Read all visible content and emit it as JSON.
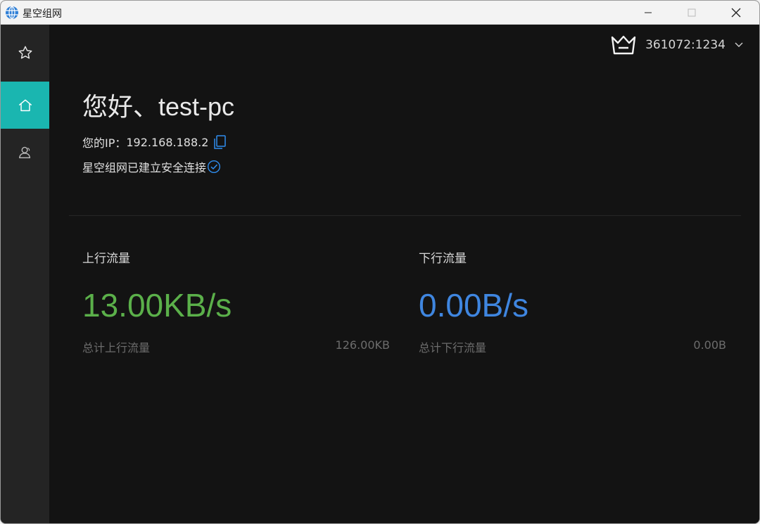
{
  "window": {
    "title": "星空组网"
  },
  "sidebar": {
    "items": [
      {
        "icon": "star-icon",
        "active": false
      },
      {
        "icon": "home-icon",
        "active": true
      },
      {
        "icon": "contacts-icon",
        "active": false
      }
    ]
  },
  "header": {
    "account_icon": "crown-icon",
    "account_id": "361072:1234"
  },
  "main": {
    "greeting": "您好、test-pc",
    "ip_label": "您的IP：",
    "ip_value": "192.168.188.2",
    "connection_status": "星空组网已建立安全连接"
  },
  "stats": {
    "upload": {
      "title": "上行流量",
      "rate": "13.00KB/s",
      "total_label": "总计上行流量",
      "total_value": "126.00KB",
      "color": "#5bb04a"
    },
    "download": {
      "title": "下行流量",
      "rate": "0.00B/s",
      "total_label": "总计下行流量",
      "total_value": "0.00B",
      "color": "#3f86e0"
    }
  },
  "colors": {
    "accent": "#1ab6b0",
    "background": "#131313",
    "sidebar": "#242424"
  }
}
